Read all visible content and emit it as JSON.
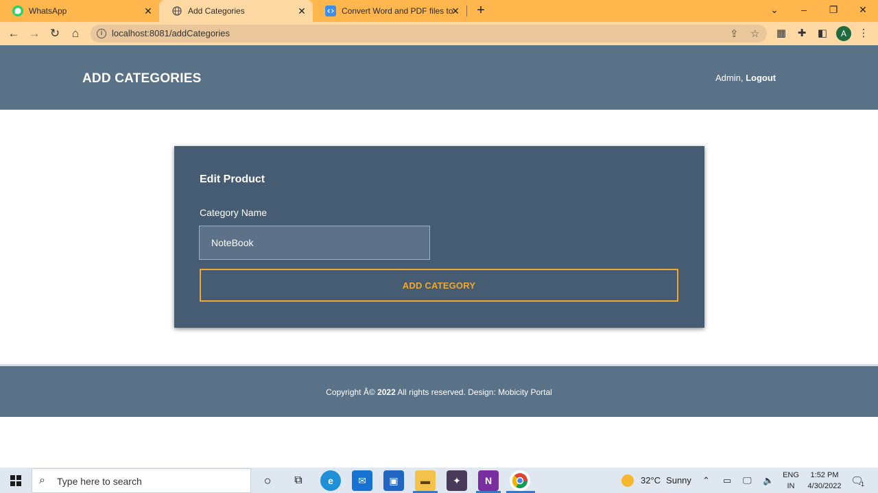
{
  "browser": {
    "tabs": [
      {
        "title": "WhatsApp",
        "favicon": "whatsapp-icon"
      },
      {
        "title": "Add Categories",
        "favicon": "globe-icon",
        "active": true
      },
      {
        "title": "Convert Word and PDF files to H",
        "favicon": "code-icon"
      }
    ],
    "url": "localhost:8081/addCategories",
    "profile_initial": "A"
  },
  "header": {
    "title": "ADD CATEGORIES",
    "user_prefix": "Admin,",
    "logout_label": "Logout"
  },
  "form": {
    "heading": "Edit Product",
    "category_label": "Category Name",
    "category_value": "NoteBook",
    "submit_label": "ADD CATEGORY"
  },
  "footer": {
    "copyright_prefix": "Copyright Â©",
    "year": "2022",
    "copyright_suffix": "All rights reserved. Design: Mobicity Portal"
  },
  "taskbar": {
    "search_placeholder": "Type here to search",
    "weather_temp": "32°C",
    "weather_desc": "Sunny",
    "lang_top": "ENG",
    "lang_bottom": "IN",
    "time": "1:52 PM",
    "date": "4/30/2022",
    "notification_count": "1"
  },
  "colors": {
    "header_bg": "#5a7287",
    "card_bg": "#465c72",
    "accent": "#f0a830",
    "tab_strip": "#ffb64d"
  }
}
